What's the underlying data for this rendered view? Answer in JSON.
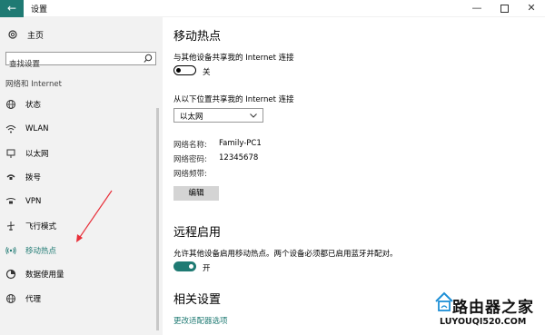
{
  "window": {
    "title": "设置",
    "back_glyph": "←",
    "minimize_glyph": "—",
    "close_glyph": "✕"
  },
  "sidebar": {
    "home_label": "主页",
    "search_placeholder": "查找设置",
    "section_label": "网络和 Internet",
    "items": [
      {
        "label": "状态",
        "icon": "globe-icon"
      },
      {
        "label": "WLAN",
        "icon": "wifi-icon"
      },
      {
        "label": "以太网",
        "icon": "ethernet-icon"
      },
      {
        "label": "拨号",
        "icon": "phone-icon"
      },
      {
        "label": "VPN",
        "icon": "vpn-icon"
      },
      {
        "label": "飞行模式",
        "icon": "airplane-icon"
      },
      {
        "label": "移动热点",
        "icon": "hotspot-icon"
      },
      {
        "label": "数据使用量",
        "icon": "data-usage-icon"
      },
      {
        "label": "代理",
        "icon": "globe-icon"
      }
    ],
    "active_index": 6
  },
  "main": {
    "title": "移动热点",
    "share_label": "与其他设备共享我的 Internet 连接",
    "share_toggle": {
      "state": "关",
      "on": false
    },
    "from_label": "从以下位置共享我的 Internet 连接",
    "from_select_value": "以太网",
    "network": {
      "name_label": "网络名称:",
      "name_value": "Family-PC1",
      "password_label": "网络密码:",
      "password_value": "12345678",
      "band_label": "网络频带:"
    },
    "edit_button": "编辑",
    "remote_title": "远程启用",
    "remote_desc": "允许其他设备启用移动热点。两个设备必须都已启用蓝牙并配对。",
    "remote_toggle": {
      "state": "开",
      "on": true
    },
    "related_title": "相关设置",
    "related_link": "更改适配器选项"
  },
  "watermark": {
    "cn": "路由器之家",
    "en": "LUYOUQI520.COM"
  },
  "colors": {
    "accent": "#1f7a73",
    "sidebar_bg": "#f2f2f2",
    "annotation_arrow": "#e8303a"
  }
}
